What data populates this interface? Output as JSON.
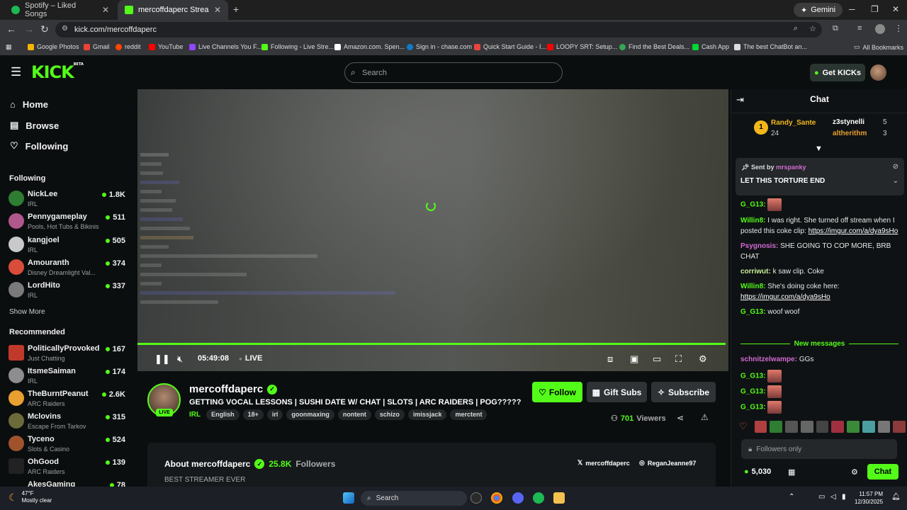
{
  "browser": {
    "tabs": [
      {
        "title": "Spotify – Liked Songs",
        "close": "✕"
      },
      {
        "title": "mercoffdaperc Stream - Watch",
        "close": "✕"
      }
    ],
    "new_tab": "+",
    "gemini": "Gemini",
    "url": "kick.com/mercoffdaperc",
    "bookmarks": [
      "Google Photos",
      "Gmail",
      "reddit",
      "YouTube",
      "Live Channels You F...",
      "Following - Live Stre...",
      "Amazon.com. Spen...",
      "Sign in - chase.com",
      "Quick Start Guide - I...",
      "LOOPY SRT: Setup...",
      "Find the Best Deals...",
      "Cash App",
      "The best ChatBot an..."
    ],
    "all_bookmarks": "All Bookmarks"
  },
  "header": {
    "logo": "KICK",
    "logo_sup": "BETA",
    "search_placeholder": "Search",
    "get_kicks": "Get KICKs"
  },
  "sidebar": {
    "nav": [
      {
        "label": "Home"
      },
      {
        "label": "Browse"
      },
      {
        "label": "Following"
      }
    ],
    "following_heading": "Following",
    "following": [
      {
        "name": "NickLee",
        "category": "IRL",
        "viewers": "1.8K"
      },
      {
        "name": "Pennygameplay",
        "category": "Pools, Hot Tubs & Bikinis",
        "viewers": "511"
      },
      {
        "name": "kangjoel",
        "category": "IRL",
        "viewers": "505"
      },
      {
        "name": "Amouranth",
        "category": "Disney Dreamlight Val...",
        "viewers": "374"
      },
      {
        "name": "LordHito",
        "category": "IRL",
        "viewers": "337"
      }
    ],
    "show_more": "Show More",
    "recommended_heading": "Recommended",
    "recommended": [
      {
        "name": "PoliticallyProvoked",
        "category": "Just Chatting",
        "viewers": "167"
      },
      {
        "name": "ItsmeSaiman",
        "category": "IRL",
        "viewers": "174"
      },
      {
        "name": "TheBurntPeanut",
        "category": "ARC Raiders",
        "viewers": "2.6K"
      },
      {
        "name": "Mclovins",
        "category": "Escape From Tarkov",
        "viewers": "315"
      },
      {
        "name": "Tyceno",
        "category": "Slots & Casino",
        "viewers": "524"
      },
      {
        "name": "OhGood",
        "category": "ARC Raiders",
        "viewers": "139"
      },
      {
        "name": "AkesGaming",
        "category": "",
        "viewers": "78"
      }
    ]
  },
  "player": {
    "time": "05:49:08",
    "live": "LIVE"
  },
  "stream": {
    "live_badge": "LIVE",
    "streamer": "mercoffdaperc",
    "title": "GETTING VOCAL LESSONS | SUSHI DATE W/ CHAT | SLOTS | ARC RAIDERS | POG?????",
    "category": "IRL",
    "tags": [
      "English",
      "18+",
      "irl",
      "goonmaxing",
      "nontent",
      "schizo",
      "imissjack",
      "merctent"
    ],
    "follow": "Follow",
    "gift_subs": "Gift Subs",
    "subscribe": "Subscribe",
    "viewers": "701",
    "viewers_label": "Viewers"
  },
  "about": {
    "heading": "About mercoffdaperc",
    "followers": "25.8K",
    "followers_label": "Followers",
    "bio": "BEST STREAMER EVER",
    "x_handle": "mercoffdaperc",
    "ig_handle": "ReganJeanne97"
  },
  "chat": {
    "title": "Chat",
    "leaderboard": {
      "first": {
        "rank": "1",
        "name": "Randy_Sante",
        "count": "24"
      },
      "second": {
        "name": "z3stynelli",
        "count": "5"
      },
      "third": {
        "name": "altherithm",
        "count": "3"
      }
    },
    "pinned": {
      "sent_by_label": "Sent by",
      "sender": "mrspanky",
      "message": "LET THIS TORTURE END"
    },
    "messages": [
      {
        "user": "G_G13:",
        "color": "#53fc18",
        "text": "",
        "link": "",
        "emote": true
      },
      {
        "user": "Willin8:",
        "color": "#53fc18",
        "text": "I was right. She turned off stream when I posted this coke clip:",
        "link": "https://imgur.com/a/dya9sHo"
      },
      {
        "user": "Psygnosis:",
        "color": "#d26ad1",
        "text": "SHE GOING TO COP MORE, BRB CHAT",
        "link": ""
      },
      {
        "user": "corriwut:",
        "color": "#c9f09a",
        "text": "k saw clip. Coke",
        "link": ""
      },
      {
        "user": "Willin8:",
        "color": "#53fc18",
        "text": "She's doing coke here:",
        "link": "https://imgur.com/a/dya9sHo"
      },
      {
        "user": "G_G13:",
        "color": "#53fc18",
        "text": "woof woof",
        "link": ""
      }
    ],
    "new_messages": "New messages",
    "new": [
      {
        "user": "schnitzelwampe:",
        "color": "#d26ad1",
        "text": "GGs",
        "emote": false
      },
      {
        "user": "G_G13:",
        "color": "#53fc18",
        "text": "",
        "emote": true
      },
      {
        "user": "G_G13:",
        "color": "#53fc18",
        "text": "",
        "emote": true
      },
      {
        "user": "G_G13:",
        "color": "#53fc18",
        "text": "",
        "emote": true
      }
    ],
    "input_placeholder": "Followers only",
    "kicks_balance": "5,030",
    "chat_button": "Chat"
  },
  "taskbar": {
    "temp": "47°F",
    "weather": "Mostly clear",
    "search": "Search",
    "time": "11:57 PM",
    "date": "12/30/2025"
  },
  "colors": {
    "accent": "#53fc18",
    "bg": "#0b0e0f"
  }
}
